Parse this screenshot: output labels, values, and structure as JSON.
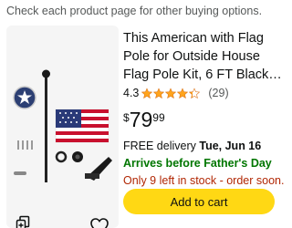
{
  "notice": "Check each product page for other buying options.",
  "product": {
    "title": "This American with Flag Pole for Outside House Flag Pole Kit, 6 FT Black…",
    "rating_value": "4.3",
    "rating_stars": 4.3,
    "rating_count": "(29)",
    "price": {
      "symbol": "$",
      "whole": "79",
      "fraction": "99"
    },
    "delivery_prefix": "FREE delivery ",
    "delivery_date": "Tue, Jun 16",
    "arrives_note": "Arrives before Father's Day",
    "stock_note": "Only 9 left in stock - order soon.",
    "add_to_cart_label": "Add to cart"
  },
  "colors": {
    "accent_button": "#ffd814",
    "star": "#ffa41c",
    "delivery_green": "#007600",
    "stock_red": "#b12704"
  },
  "icons": {
    "compare": "compare-icon",
    "wishlist": "heart-outline-icon"
  }
}
